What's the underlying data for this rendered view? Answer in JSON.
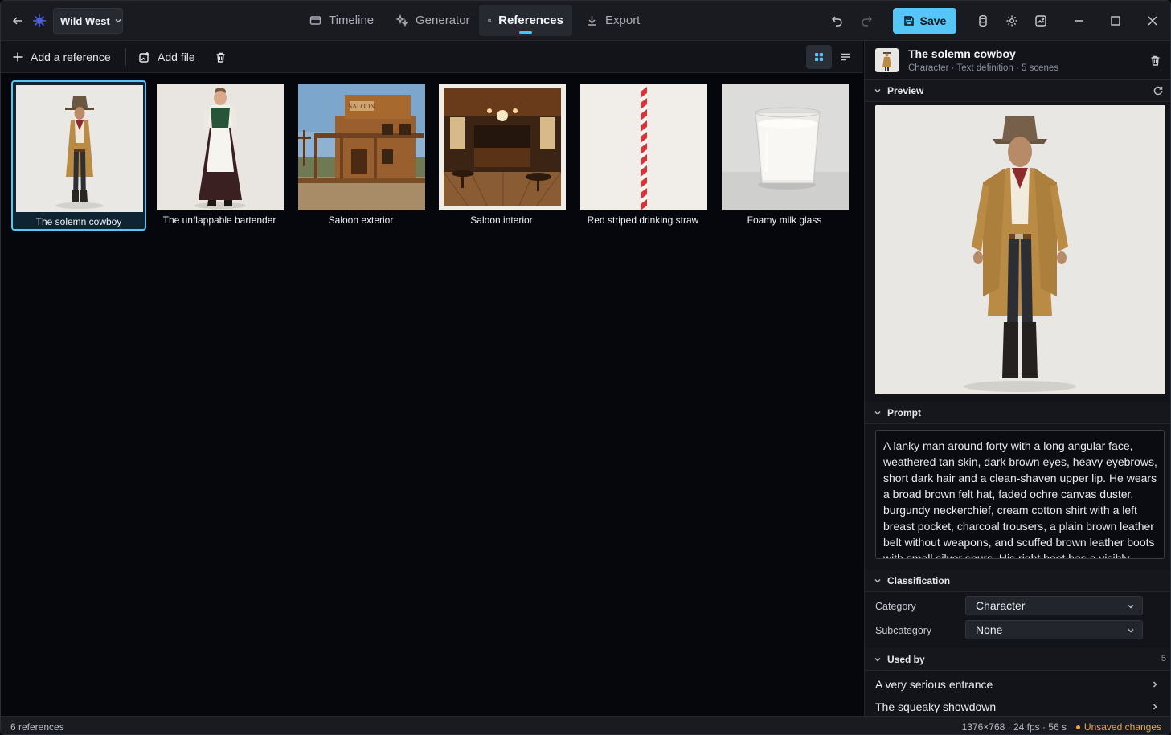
{
  "titlebar": {
    "project_name": "Wild West",
    "tabs": [
      {
        "label": "Timeline",
        "icon": "timeline-icon",
        "active": false
      },
      {
        "label": "Generator",
        "icon": "sparkle-icon",
        "active": false
      },
      {
        "label": "References",
        "icon": "book-icon",
        "active": true
      },
      {
        "label": "Export",
        "icon": "download-icon",
        "active": false
      }
    ],
    "save_label": "Save",
    "accent_color": "#56c6f4"
  },
  "toolbar": {
    "add_reference_label": "Add a reference",
    "add_file_label": "Add file",
    "view_mode": "grid"
  },
  "references": [
    {
      "name": "The solemn cowboy",
      "selected": true
    },
    {
      "name": "The unflappable bartender",
      "selected": false
    },
    {
      "name": "Saloon exterior",
      "selected": false
    },
    {
      "name": "Saloon interior",
      "selected": false
    },
    {
      "name": "Red striped drinking straw",
      "selected": false
    },
    {
      "name": "Foamy milk glass",
      "selected": false
    }
  ],
  "panel": {
    "title": "The solemn cowboy",
    "subtitle": "Character · Text definition · 5 scenes",
    "preview_label": "Preview",
    "prompt_label": "Prompt",
    "prompt_text": "A lanky man around forty with a long angular face, weathered tan skin, dark brown eyes, heavy eyebrows, short dark hair and a clean-shaven upper lip. He wears a broad brown felt hat, faded ochre canvas duster, burgundy neckerchief, cream cotton shirt with a left breast pocket, charcoal trousers, a plain brown leather belt without weapons, and scuffed brown leather boots with small silver spurs. His right boot has a visibly loose",
    "classification_label": "Classification",
    "category_label": "Category",
    "category_value": "Character",
    "subcategory_label": "Subcategory",
    "subcategory_value": "None",
    "used_by_label": "Used by",
    "used_by_count": "5",
    "used_by": [
      "A very serious entrance",
      "The squeaky showdown"
    ]
  },
  "status": {
    "count_text": "6 references",
    "meta_text": "1376×768 · 24 fps · 56 s",
    "unsaved_text": "Unsaved changes",
    "unsaved_color": "#f0a63b"
  }
}
